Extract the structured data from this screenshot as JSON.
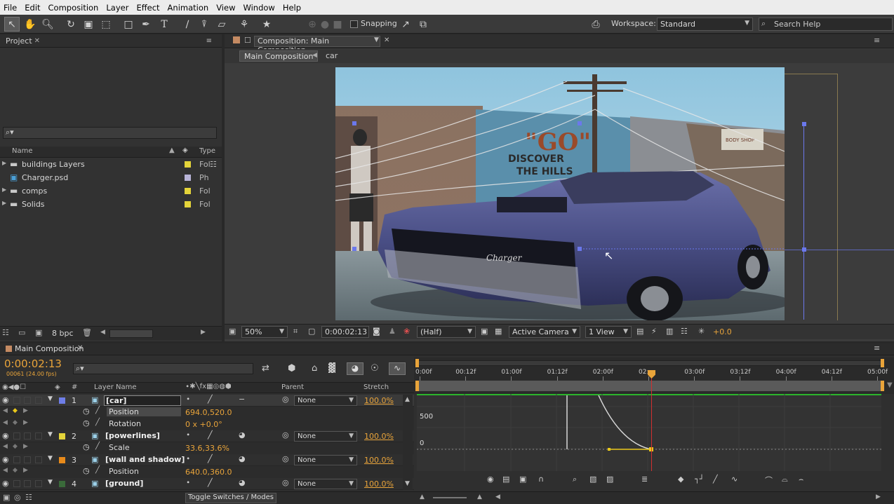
{
  "menu": [
    "File",
    "Edit",
    "Composition",
    "Layer",
    "Effect",
    "Animation",
    "View",
    "Window",
    "Help"
  ],
  "toolbar": {
    "snapping_label": "Snapping",
    "workspace_label": "Workspace:",
    "workspace_value": "Standard",
    "search_placeholder": "Search Help"
  },
  "project": {
    "tab_label": "Project",
    "col_name": "Name",
    "col_type": "Type",
    "items": [
      {
        "name": "buildings Layers",
        "type": "Fol",
        "color": "#e4d43a",
        "kind": "folder"
      },
      {
        "name": "Charger.psd",
        "type": "Ph",
        "color": "#b8b4d8",
        "kind": "psd"
      },
      {
        "name": "comps",
        "type": "Fol",
        "color": "#e4d43a",
        "kind": "folder"
      },
      {
        "name": "Solids",
        "type": "Fol",
        "color": "#e4d43a",
        "kind": "folder"
      }
    ],
    "bpc_label": "8 bpc"
  },
  "composition": {
    "tab_label": "Composition: Main Composition",
    "breadcrumb_main": "Main Composition",
    "breadcrumb_layer": "car",
    "zoom": "50%",
    "timecode": "0:00:02:13",
    "resolution": "(Half)",
    "camera": "Active Camera",
    "view": "1 View",
    "exposure": "+0.0",
    "image_text": {
      "go": "\"GO\"",
      "discover": "DISCOVER",
      "hills": "THE HILLS",
      "sign": "BODY SHOP",
      "badge": "Charger"
    }
  },
  "timeline": {
    "tab_label": "Main Composition",
    "timecode": "0:00:02:13",
    "frame_info": "00061 (24.00 fps)",
    "col_layer_name": "Layer Name",
    "col_parent": "Parent",
    "col_stretch": "Stretch",
    "col_num": "#",
    "toggle_label": "Toggle Switches / Modes",
    "ruler": [
      "0:00f",
      "00:12f",
      "01:00f",
      "01:12f",
      "02:00f",
      "02:",
      "03:00f",
      "03:12f",
      "04:00f",
      "04:12f",
      "05:00f"
    ],
    "graph_labels": [
      "500",
      "0"
    ],
    "layers": [
      {
        "num": "1",
        "name": "[car]",
        "color": "#6e7ee8",
        "parent": "None",
        "stretch": "100.0%",
        "props": [
          {
            "name": "Position",
            "value": "694.0,520.0"
          },
          {
            "name": "Rotation",
            "value": "0 x +0.0°"
          }
        ]
      },
      {
        "num": "2",
        "name": "[powerlines]",
        "color": "#e4d43a",
        "parent": "None",
        "stretch": "100.0%",
        "props": [
          {
            "name": "Scale",
            "value": "33.6,33.6%"
          }
        ]
      },
      {
        "num": "3",
        "name": "[wall and shadow]",
        "color": "#e88a1a",
        "parent": "None",
        "stretch": "100.0%",
        "props": [
          {
            "name": "Position",
            "value": "640.0,360.0"
          }
        ]
      },
      {
        "num": "4",
        "name": "[ground]",
        "color": "#3a6a3a",
        "parent": "None",
        "stretch": "100.0%",
        "props": []
      }
    ]
  }
}
